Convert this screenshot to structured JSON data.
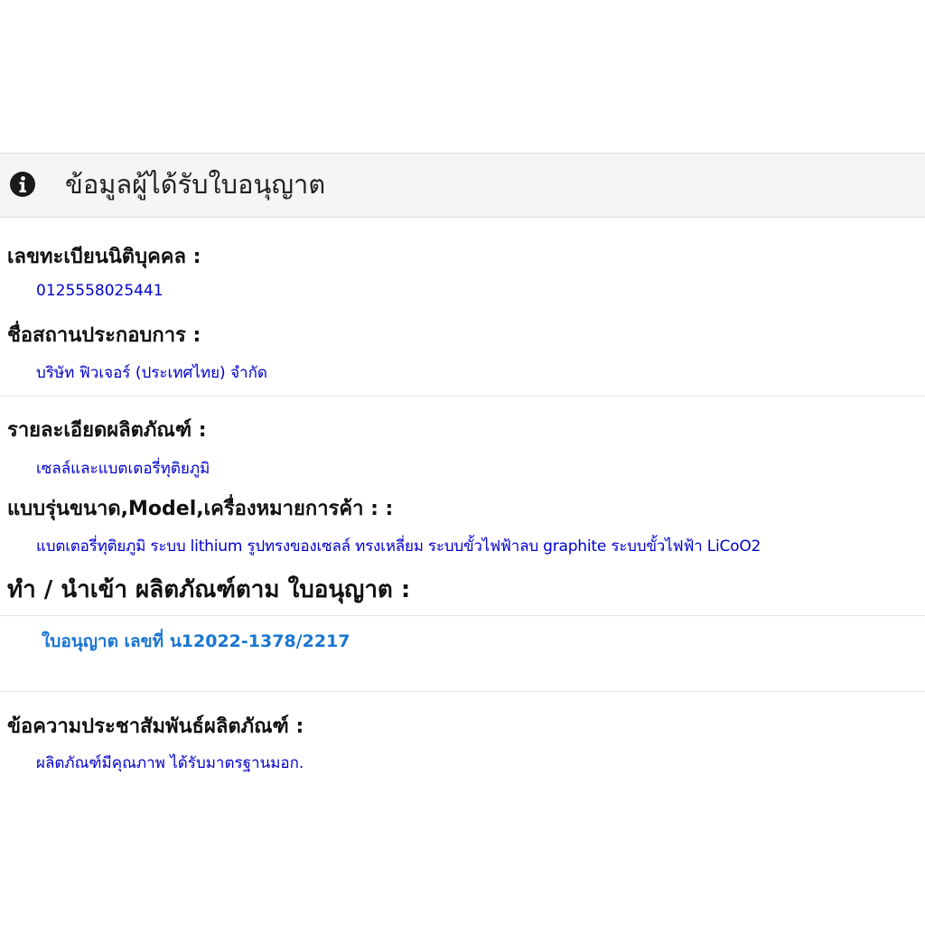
{
  "panel": {
    "title": "ข้อมูลผู้ได้รับใบอนุญาต"
  },
  "fields": {
    "registration_label": "เลขทะเบียนนิติบุคคล :",
    "registration_value": "0125558025441",
    "company_label": "ชื่อสถานประกอบการ :",
    "company_value": "บริษัท ฟิวเจอร์ (ประเทศไทย) จำกัด",
    "product_detail_label": "รายละเอียดผลิตภัณฑ์ :",
    "product_detail_value": "เซลล์และแบตเตอรี่ทุติยภูมิ",
    "model_label": "แบบรุ่นขนาด,Model,เครื่องหมายการค้า : :",
    "model_value": "แบตเตอรี่ทุติยภูมิ ระบบ lithium รูปทรงของเซลล์ ทรงเหลี่ยม ระบบขั้วไฟฟ้าลบ graphite ระบบขั้วไฟฟ้า LiCoO2",
    "import_label": "ทำ / นำเข้า ผลิตภัณฑ์ตาม ใบอนุญาต :",
    "license_link": "ใบอนุญาต เลขที่ น12022-1378/2217",
    "promo_label": "ข้อความประชาสัมพันธ์ผลิตภัณฑ์ :",
    "promo_value": "ผลิตภัณฑ์มีคุณภาพ ได้รับมาตรฐานมอก."
  },
  "colors": {
    "value_text": "#0000cc",
    "link": "#1a76d2",
    "header_bg": "#f5f5f5"
  },
  "icons": {
    "header": "info-circle-icon"
  }
}
